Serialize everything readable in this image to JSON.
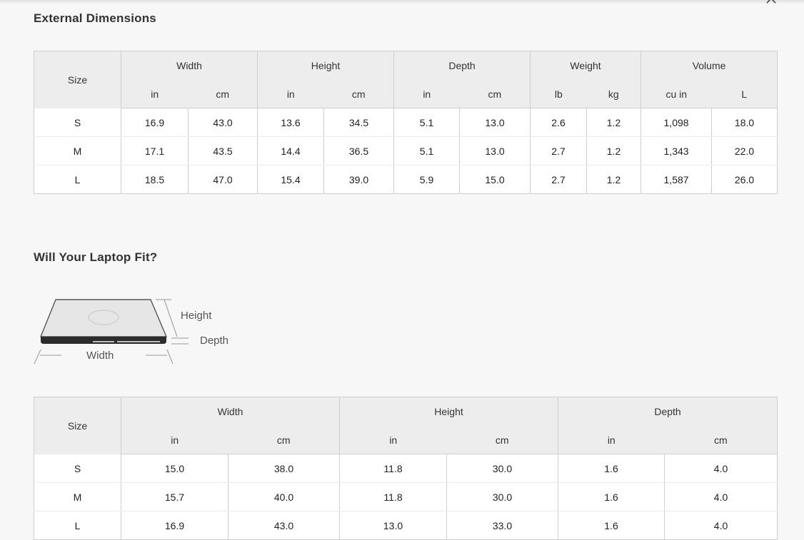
{
  "external": {
    "title": "External Dimensions",
    "size_header": "Size",
    "groups": [
      {
        "label": "Width",
        "units": [
          "in",
          "cm"
        ]
      },
      {
        "label": "Height",
        "units": [
          "in",
          "cm"
        ]
      },
      {
        "label": "Depth",
        "units": [
          "in",
          "cm"
        ]
      },
      {
        "label": "Weight",
        "units": [
          "lb",
          "kg"
        ]
      },
      {
        "label": "Volume",
        "units": [
          "cu in",
          "L"
        ]
      }
    ],
    "rows": [
      {
        "size": "S",
        "values": [
          "16.9",
          "43.0",
          "13.6",
          "34.5",
          "5.1",
          "13.0",
          "2.6",
          "1.2",
          "1,098",
          "18.0"
        ]
      },
      {
        "size": "M",
        "values": [
          "17.1",
          "43.5",
          "14.4",
          "36.5",
          "5.1",
          "13.0",
          "2.7",
          "1.2",
          "1,343",
          "22.0"
        ]
      },
      {
        "size": "L",
        "values": [
          "18.5",
          "47.0",
          "15.4",
          "39.0",
          "5.9",
          "15.0",
          "2.7",
          "1.2",
          "1,587",
          "26.0"
        ]
      }
    ]
  },
  "laptop_fit": {
    "title": "Will Your Laptop Fit?",
    "diagram_labels": {
      "height": "Height",
      "depth": "Depth",
      "width": "Width"
    },
    "size_header": "Size",
    "groups": [
      {
        "label": "Width",
        "units": [
          "in",
          "cm"
        ]
      },
      {
        "label": "Height",
        "units": [
          "in",
          "cm"
        ]
      },
      {
        "label": "Depth",
        "units": [
          "in",
          "cm"
        ]
      }
    ],
    "rows": [
      {
        "size": "S",
        "values": [
          "15.0",
          "38.0",
          "11.8",
          "30.0",
          "1.6",
          "4.0"
        ]
      },
      {
        "size": "M",
        "values": [
          "15.7",
          "40.0",
          "11.8",
          "30.0",
          "1.6",
          "4.0"
        ]
      },
      {
        "size": "L",
        "values": [
          "16.9",
          "43.0",
          "13.0",
          "33.0",
          "1.6",
          "4.0"
        ]
      }
    ]
  },
  "icons": {
    "close": "close-icon",
    "laptop": "laptop-diagram-icon"
  }
}
